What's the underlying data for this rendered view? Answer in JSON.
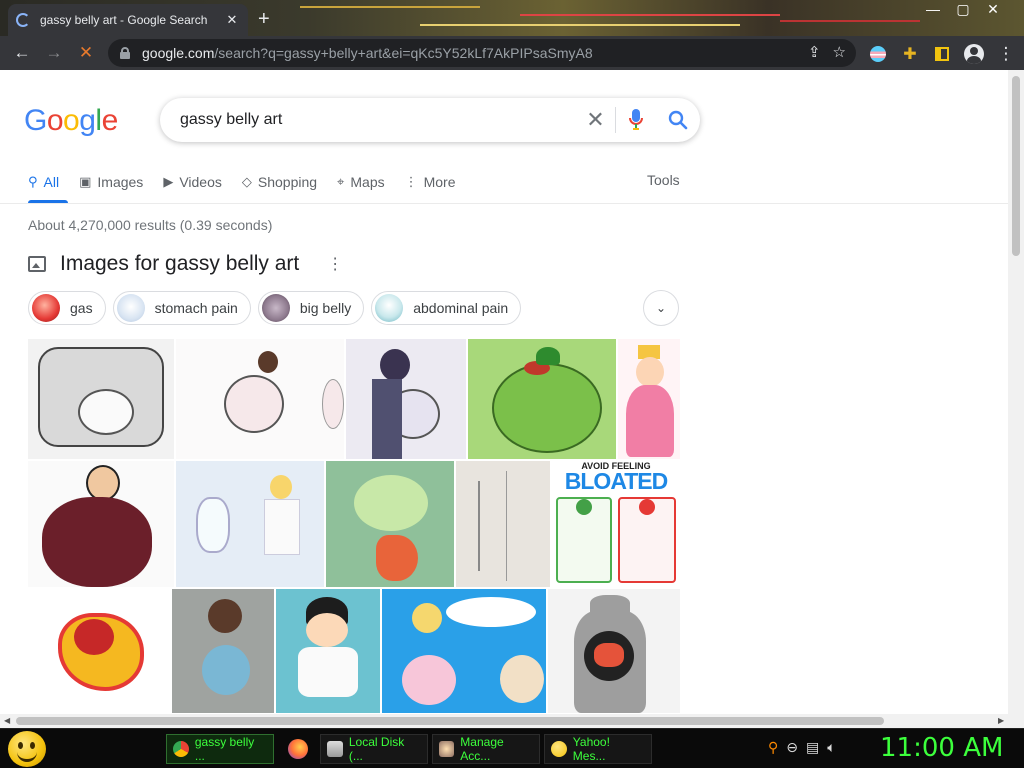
{
  "browser": {
    "tab_title": "gassy belly art - Google Search",
    "tab_close": "✕",
    "new_tab": "+",
    "window_controls": [
      "—",
      "▢",
      "✕"
    ],
    "url_host": "google.com",
    "url_rest": "/search?q=gassy+belly+art&ei=qKc5Y52kLf7AkPIPsaSmyA8"
  },
  "google": {
    "logo": [
      "G",
      "o",
      "o",
      "g",
      "l",
      "e"
    ],
    "query": "gassy belly art",
    "clear": "✕",
    "tabs": [
      {
        "label": "All",
        "icon": "search-icon",
        "glyph": "⚲"
      },
      {
        "label": "Images",
        "icon": "image-icon",
        "glyph": "▣"
      },
      {
        "label": "Videos",
        "icon": "video-icon",
        "glyph": "▶"
      },
      {
        "label": "Shopping",
        "icon": "tag-icon",
        "glyph": "◇"
      },
      {
        "label": "Maps",
        "icon": "pin-icon",
        "glyph": "⌖"
      },
      {
        "label": "More",
        "icon": "more-vert-icon",
        "glyph": "⋮"
      }
    ],
    "tools": "Tools",
    "stats": "About 4,270,000 results (0.39 seconds)",
    "images_header": "Images for gassy belly art",
    "header_menu": "⋮",
    "chips": [
      "gas",
      "stomach pain",
      "big belly",
      "abdominal pain"
    ],
    "chips_more": "⌄",
    "tile_text": {
      "avoid": "AVOID FEELING",
      "bloated": "BLOATED"
    }
  },
  "taskbar": {
    "buttons": [
      {
        "label": "gassy belly ...",
        "icon": "chrome-icon"
      },
      {
        "label": "Local Disk (...",
        "icon": "drive-icon"
      },
      {
        "label": "Manage Acc...",
        "icon": "users-icon"
      },
      {
        "label": "Yahoo! Mes...",
        "icon": "yahoo-messenger-icon"
      }
    ],
    "clock": "11:00 AM"
  },
  "colors": {
    "accent": "#1a73e8",
    "chrome_dark": "#35363a",
    "taskbar_text": "#3cff3c"
  }
}
